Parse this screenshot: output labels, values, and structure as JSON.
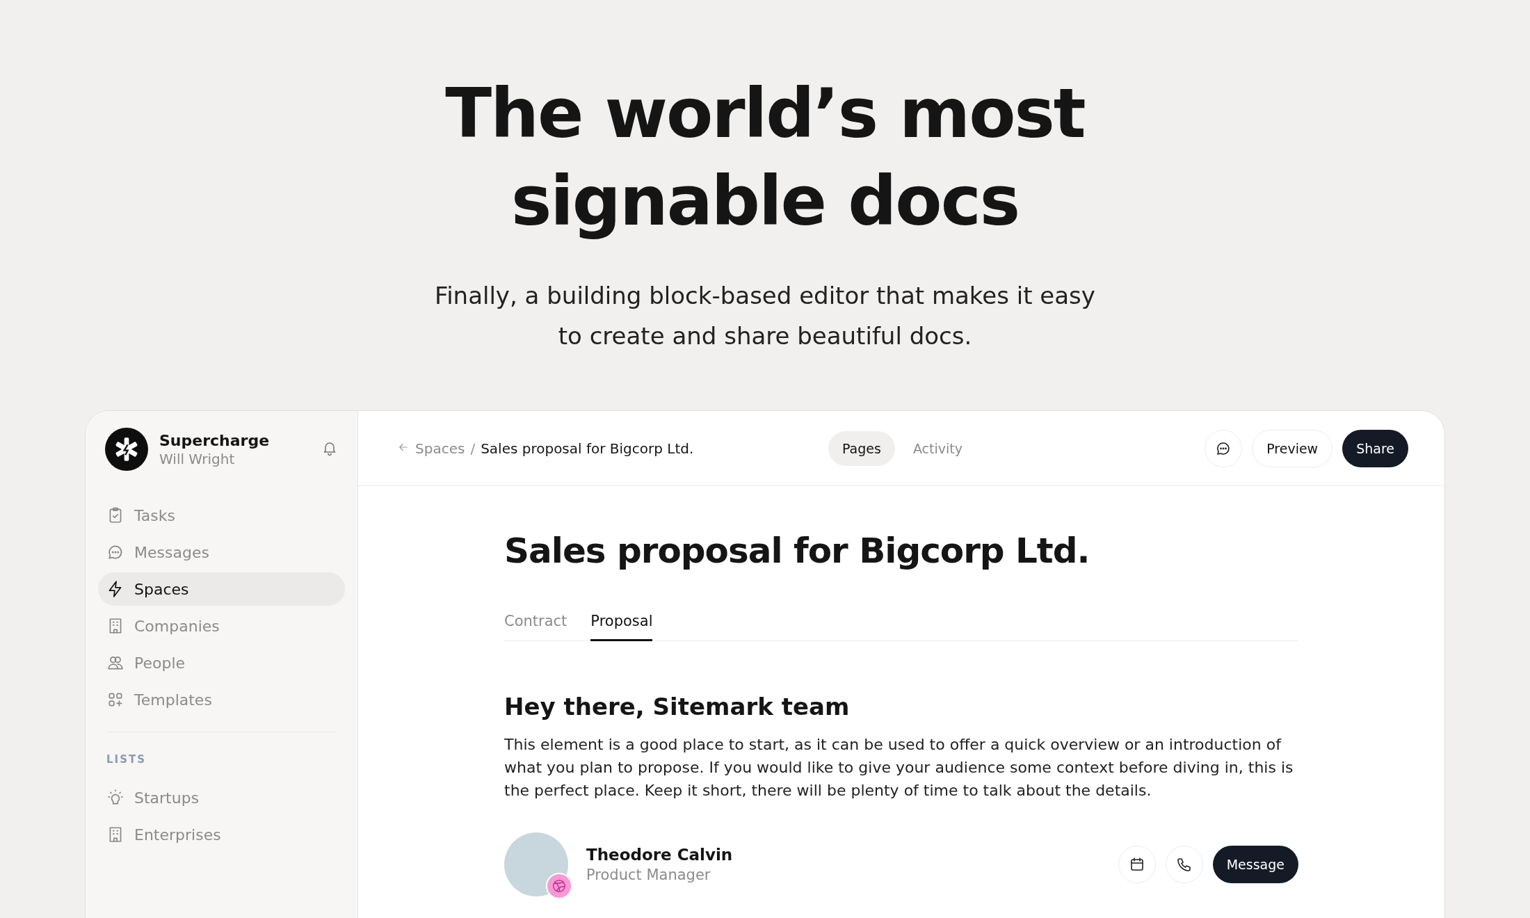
{
  "hero": {
    "title_lines": [
      "The world’s most",
      "signable docs"
    ],
    "subtitle_lines": [
      "Finally, a building block-based editor that makes it easy",
      "to create and share beautiful docs."
    ]
  },
  "sidebar": {
    "workspace": "Supercharge",
    "user": "Will Wright",
    "items": [
      {
        "label": "Tasks",
        "kind": "clipboard",
        "selected": false
      },
      {
        "label": "Messages",
        "kind": "chat",
        "selected": false
      },
      {
        "label": "Spaces",
        "kind": "bolt",
        "selected": true
      },
      {
        "label": "Companies",
        "kind": "building",
        "selected": false
      },
      {
        "label": "People",
        "kind": "people",
        "selected": false
      },
      {
        "label": "Templates",
        "kind": "grid",
        "selected": false
      }
    ],
    "lists_heading": "LISTS",
    "lists": [
      {
        "label": "Startups",
        "kind": "bulb",
        "selected": false
      },
      {
        "label": "Enterprises",
        "kind": "building",
        "selected": false
      }
    ]
  },
  "topbar": {
    "breadcrumb": [
      "Spaces",
      "Sales proposal for Bigcorp Ltd."
    ],
    "breadcrumb_separator": "/",
    "tabs": [
      {
        "label": "Pages",
        "selected": true
      },
      {
        "label": "Activity",
        "selected": false
      }
    ],
    "buttons": [
      {
        "label": "Preview",
        "kind": "outline"
      },
      {
        "label": "Share",
        "kind": "primary"
      }
    ]
  },
  "document": {
    "title": "Sales proposal for Bigcorp Ltd.",
    "tabs": [
      {
        "label": "Contract",
        "selected": false
      },
      {
        "label": "Proposal",
        "selected": true
      }
    ],
    "heading": "Hey there, Sitemark team",
    "paragraph": "This element is a good place to start, as it can be used to offer a quick overview or an introduction of what you plan to propose. If you would like to give your audience some context before diving in, this is the perfect place. Keep it short, there will be plenty of time to talk about the details.",
    "contact": {
      "name": "Theodore Calvin",
      "role": "Product Manager",
      "button": "Message"
    }
  }
}
